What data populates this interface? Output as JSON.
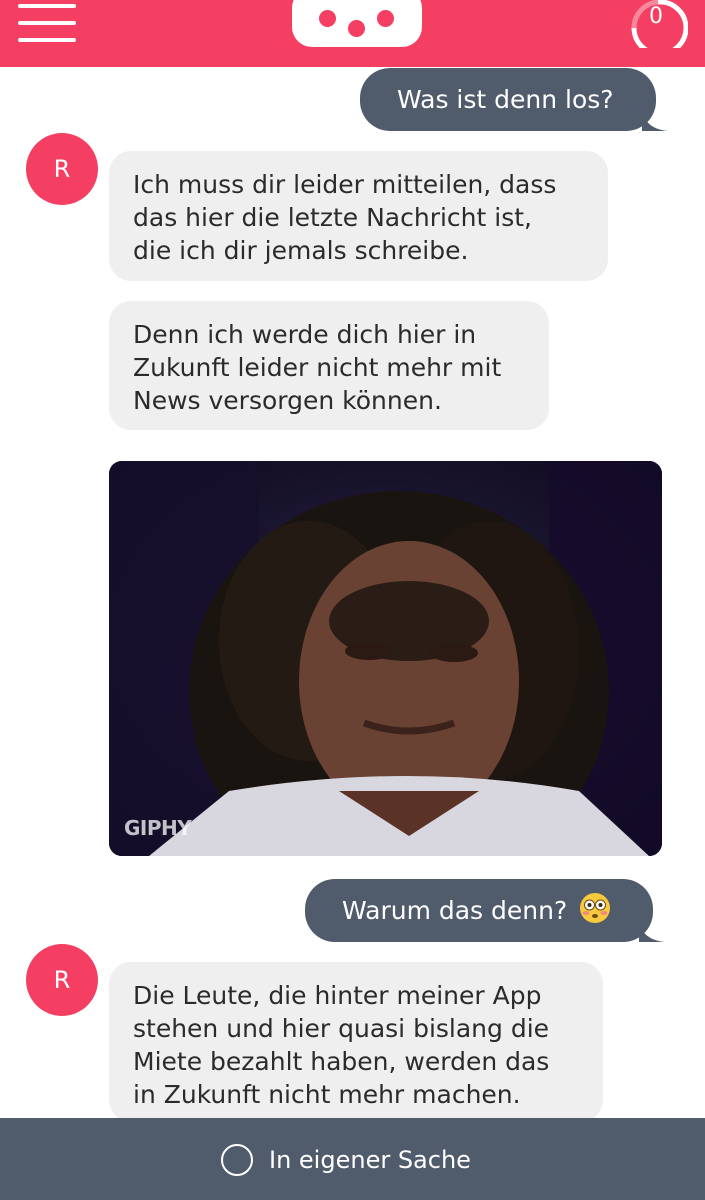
{
  "header": {
    "menu_icon": "hamburger-menu-icon",
    "logo_icon": "chat-bubble-dots-logo",
    "counter": "0",
    "accent_color": "#f43f62"
  },
  "messages": [
    {
      "from": "user",
      "text": "Was ist denn los?"
    },
    {
      "from": "bot",
      "avatar": "R",
      "lines": [
        "Ich muss dir leider mitteilen, dass",
        "das hier die letzte Nachricht ist,",
        "die ich dir jemals schreibe."
      ]
    },
    {
      "from": "bot",
      "lines": [
        "Denn ich werde dich hier in",
        "Zukunft leider nicht mehr mit",
        "News versorgen können."
      ]
    },
    {
      "from": "bot",
      "type": "gif",
      "watermark": "GIPHY"
    },
    {
      "from": "user",
      "text": "Warum das denn?",
      "emoji": "flushed-face-emoji"
    },
    {
      "from": "bot",
      "avatar": "R",
      "lines": [
        "Die Leute, die hinter meiner App",
        "stehen und hier quasi bislang die",
        "Miete bezahlt haben, werden das",
        "in Zukunft nicht mehr machen."
      ]
    }
  ],
  "footer": {
    "reply_label": "In eigener Sache",
    "bar_color": "#505c6b"
  }
}
